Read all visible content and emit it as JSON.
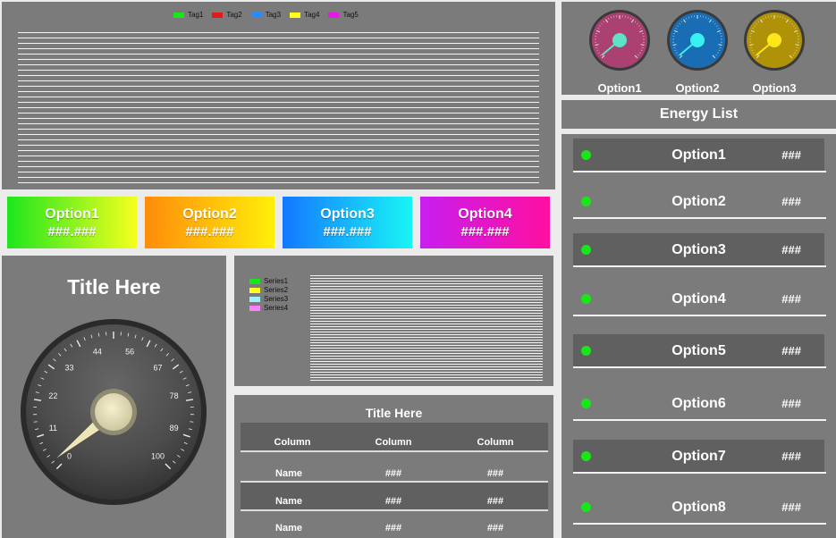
{
  "top_chart": {
    "legend": [
      {
        "label": "Tag1",
        "color": "#19e619"
      },
      {
        "label": "Tag2",
        "color": "#e61919"
      },
      {
        "label": "Tag3",
        "color": "#2a8cff"
      },
      {
        "label": "Tag4",
        "color": "#ffff19"
      },
      {
        "label": "Tag5",
        "color": "#e619e6"
      }
    ]
  },
  "tiles": [
    {
      "label": "Option1",
      "value": "###.###"
    },
    {
      "label": "Option2",
      "value": "###.###"
    },
    {
      "label": "Option3",
      "value": "###.###"
    },
    {
      "label": "Option4",
      "value": "###.###"
    }
  ],
  "small_gauges": [
    {
      "label": "Option1",
      "color": "#d0508a"
    },
    {
      "label": "Option2",
      "color": "#1f86dd"
    },
    {
      "label": "Option3",
      "color": "#d7b20a"
    }
  ],
  "energy_list": {
    "title": "Energy List",
    "items": [
      {
        "label": "Option1",
        "value": "###"
      },
      {
        "label": "Option2",
        "value": "###"
      },
      {
        "label": "Option3",
        "value": "###"
      },
      {
        "label": "Option4",
        "value": "###"
      },
      {
        "label": "Option5",
        "value": "###"
      },
      {
        "label": "Option6",
        "value": "###"
      },
      {
        "label": "Option7",
        "value": "###"
      },
      {
        "label": "Option8",
        "value": "###"
      }
    ]
  },
  "big_gauge": {
    "title": "Title Here",
    "ticks": [
      "0",
      "11",
      "22",
      "33",
      "44",
      "56",
      "67",
      "78",
      "89",
      "100"
    ]
  },
  "series_chart": {
    "legend": [
      {
        "label": "Series1",
        "color": "#19e619"
      },
      {
        "label": "Series2",
        "color": "#ffff19"
      },
      {
        "label": "Series3",
        "color": "#a0f0ff"
      },
      {
        "label": "Series4",
        "color": "#ff80ff"
      }
    ]
  },
  "table": {
    "title": "Title Here",
    "columns": [
      "Column",
      "Column",
      "Column"
    ],
    "rows": [
      [
        "Name",
        "###",
        "###"
      ],
      [
        "Name",
        "###",
        "###"
      ],
      [
        "Name",
        "###",
        "###"
      ]
    ]
  }
}
